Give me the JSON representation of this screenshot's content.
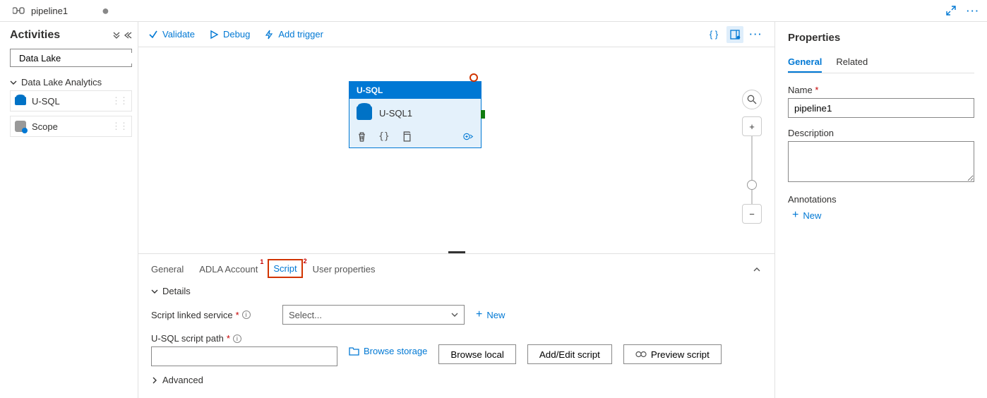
{
  "topTab": {
    "title": "pipeline1"
  },
  "sidebar": {
    "title": "Activities",
    "search_placeholder": "Data Lake",
    "category": "Data Lake Analytics",
    "items": [
      {
        "label": "U-SQL"
      },
      {
        "label": "Scope"
      }
    ]
  },
  "toolbar": {
    "validate": "Validate",
    "debug": "Debug",
    "add_trigger": "Add trigger"
  },
  "node": {
    "type": "U-SQL",
    "name": "U-SQL1"
  },
  "bottomTabs": {
    "general": "General",
    "adla": "ADLA Account",
    "script": "Script",
    "user_props": "User properties",
    "badge1": "1",
    "badge2": "2"
  },
  "details": {
    "header": "Details",
    "linked_label": "Script linked service",
    "select_placeholder": "Select...",
    "new_link": "New",
    "path_label": "U-SQL script path",
    "browse_storage": "Browse storage",
    "browse_local": "Browse local",
    "add_edit": "Add/Edit script",
    "preview": "Preview script",
    "advanced": "Advanced"
  },
  "props": {
    "title": "Properties",
    "tab_general": "General",
    "tab_related": "Related",
    "name_label": "Name",
    "name_value": "pipeline1",
    "desc_label": "Description",
    "desc_value": "",
    "annotations_label": "Annotations",
    "new_annotation": "New"
  }
}
